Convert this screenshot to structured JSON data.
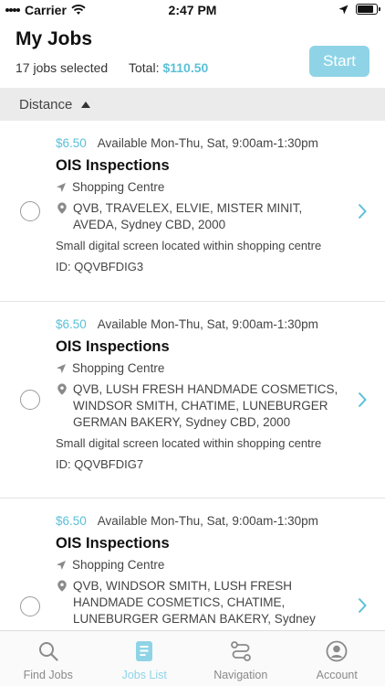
{
  "status_bar": {
    "carrier": "Carrier",
    "time": "2:47 PM",
    "battery_level": 0.85
  },
  "header": {
    "title": "My Jobs",
    "selected_count": "17 jobs selected",
    "total_label": "Total:",
    "total_amount": "$110.50",
    "start_label": "Start"
  },
  "sort_bar": {
    "label": "Distance",
    "direction": "ascending"
  },
  "jobs": [
    {
      "price": "$6.50",
      "availability": "Available Mon-Thu, Sat, 9:00am-1:30pm",
      "title": "OIS Inspections",
      "category": "Shopping Centre",
      "address": "QVB, TRAVELEX, ELVIE, MISTER MINIT, AVEDA, Sydney CBD, 2000",
      "description": "Small digital screen located within shopping centre",
      "id": "ID: QQVBFDIG3"
    },
    {
      "price": "$6.50",
      "availability": "Available Mon-Thu, Sat, 9:00am-1:30pm",
      "title": "OIS Inspections",
      "category": "Shopping Centre",
      "address": "QVB, LUSH FRESH HANDMADE COSMETICS, WINDSOR SMITH, CHATIME, LUNEBURGER GERMAN BAKERY, Sydney CBD, 2000",
      "description": "Small digital screen located within shopping centre",
      "id": "ID: QQVBFDIG7"
    },
    {
      "price": "$6.50",
      "availability": "Available Mon-Thu, Sat, 9:00am-1:30pm",
      "title": "OIS Inspections",
      "category": "Shopping Centre",
      "address": "QVB, WINDSOR SMITH, LUSH FRESH HANDMADE COSMETICS, CHATIME, LUNEBURGER GERMAN BAKERY, Sydney CBD,",
      "description": "",
      "id": ""
    }
  ],
  "tabs": [
    {
      "label": "Find Jobs",
      "icon": "search-icon",
      "active": false
    },
    {
      "label": "Jobs List",
      "icon": "jobs-list-icon",
      "active": true
    },
    {
      "label": "Navigation",
      "icon": "route-icon",
      "active": false
    },
    {
      "label": "Account",
      "icon": "account-icon",
      "active": false
    }
  ],
  "colors": {
    "accent": "#5bc0d8",
    "start_button": "#8fd4e6",
    "sort_bar": "#ebebeb"
  }
}
